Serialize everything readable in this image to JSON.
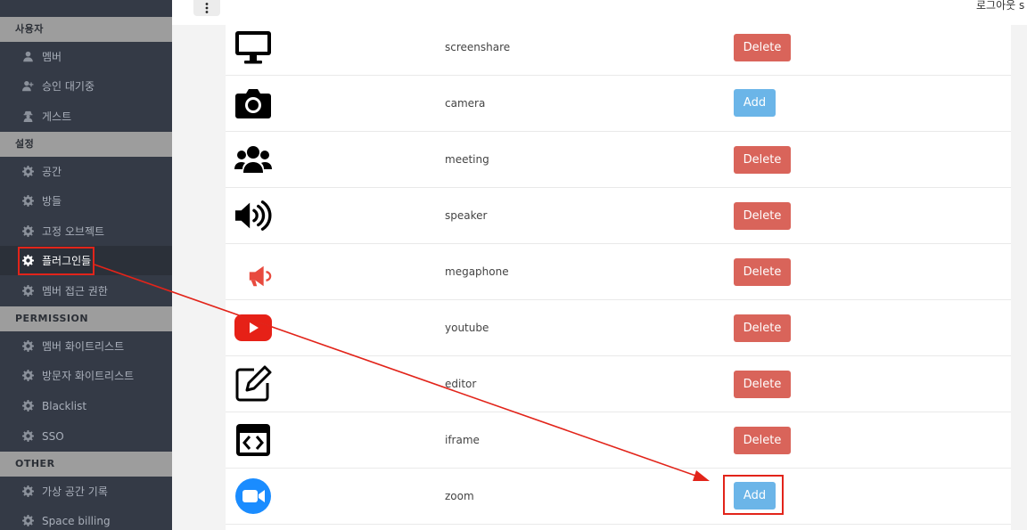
{
  "topbar": {
    "logout_label": "로그아웃 s"
  },
  "sidebar": {
    "sections": [
      {
        "header": "사용자",
        "items": [
          {
            "label": "멤버",
            "icon": "user-icon"
          },
          {
            "label": "승인 대기중",
            "icon": "user-plus-icon"
          },
          {
            "label": "게스트",
            "icon": "user-secret-icon"
          }
        ]
      },
      {
        "header": "설정",
        "items": [
          {
            "label": "공간",
            "icon": "gear-icon"
          },
          {
            "label": "방들",
            "icon": "gear-icon"
          },
          {
            "label": "고정 오브젝트",
            "icon": "gear-icon"
          },
          {
            "label": "플러그인들",
            "icon": "gear-icon",
            "active": true
          },
          {
            "label": "멤버 접근 권한",
            "icon": "gear-icon"
          }
        ]
      },
      {
        "header": "PERMISSION",
        "items": [
          {
            "label": "멤버 화이트리스트",
            "icon": "gear-icon"
          },
          {
            "label": "방문자 화이트리스트",
            "icon": "gear-icon"
          },
          {
            "label": "Blacklist",
            "icon": "gear-icon"
          },
          {
            "label": "SSO",
            "icon": "gear-icon"
          }
        ]
      },
      {
        "header": "OTHER",
        "items": [
          {
            "label": "가상 공간 기록",
            "icon": "gear-icon"
          },
          {
            "label": "Space billing",
            "icon": "gear-icon"
          }
        ]
      }
    ]
  },
  "plugins": [
    {
      "name": "screenshare",
      "icon": "desktop-icon",
      "action": "Delete"
    },
    {
      "name": "camera",
      "icon": "camera-icon",
      "action": "Add"
    },
    {
      "name": "meeting",
      "icon": "users-icon",
      "action": "Delete"
    },
    {
      "name": "speaker",
      "icon": "speaker-icon",
      "action": "Delete"
    },
    {
      "name": "megaphone",
      "icon": "megaphone-icon",
      "action": "Delete"
    },
    {
      "name": "youtube",
      "icon": "youtube-icon",
      "action": "Delete"
    },
    {
      "name": "editor",
      "icon": "edit-icon",
      "action": "Delete"
    },
    {
      "name": "iframe",
      "icon": "code-window-icon",
      "action": "Delete"
    },
    {
      "name": "zoom",
      "icon": "zoom-icon",
      "action": "Add"
    }
  ],
  "colors": {
    "delete": "#d9645a",
    "add": "#6bb5e8",
    "annotation": "#e2241a",
    "sidebar": "#343a46"
  }
}
